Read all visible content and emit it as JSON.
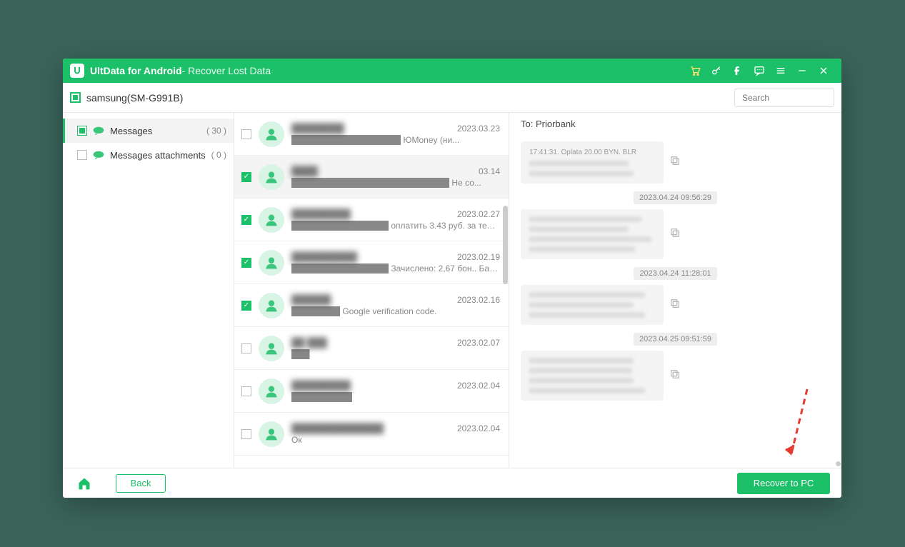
{
  "titlebar": {
    "app_name": "UltData for Android",
    "subtitle": "Recover Lost Data"
  },
  "subbar": {
    "device": "samsung(SM-G991B)",
    "search_placeholder": "Search"
  },
  "sidebar": {
    "items": [
      {
        "label": "Messages",
        "count": "( 30 )"
      },
      {
        "label": "Messages attachments",
        "count": "( 0 )"
      }
    ]
  },
  "conversations": [
    {
      "name": "████████",
      "date": "2023.03.23",
      "preview": "██████████████████ ЮMoney (ни...",
      "checked": false,
      "selected": false
    },
    {
      "name": "████",
      "date": "03.14",
      "preview": "██████████████████████████ Не со...",
      "checked": true,
      "selected": true
    },
    {
      "name": "█████████",
      "date": "2023.02.27",
      "preview": "████████████████ оплатить 3.43 руб. за телефо...",
      "checked": true,
      "selected": false
    },
    {
      "name": "██████████",
      "date": "2023.02.19",
      "preview": "████████████████ Зачислено: 2,67 бон.. Бал...",
      "checked": true,
      "selected": false
    },
    {
      "name": "██████",
      "date": "2023.02.16",
      "preview": "████████ Google verification code.",
      "checked": true,
      "selected": false
    },
    {
      "name": "██ ███",
      "date": "2023.02.07",
      "preview": "███",
      "checked": false,
      "selected": false
    },
    {
      "name": "█████████",
      "date": "2023.02.04",
      "preview": "██████████",
      "checked": false,
      "selected": false
    },
    {
      "name": "██████████████",
      "date": "2023.02.04",
      "preview": "Ок",
      "checked": false,
      "selected": false
    }
  ],
  "chat": {
    "to_label": "To:",
    "to": "Priorbank",
    "messages": [
      {
        "ts": "",
        "top": "17:41:31. Oplata 20.00 BYN. BLR",
        "lines": 2
      },
      {
        "ts": "2023.04.24 09:56:29",
        "lines": 4
      },
      {
        "ts": "2023.04.24 11:28:01",
        "lines": 3
      },
      {
        "ts": "2023.04.25 09:51:59",
        "lines": 4
      }
    ]
  },
  "footer": {
    "back": "Back",
    "recover": "Recover to PC"
  }
}
